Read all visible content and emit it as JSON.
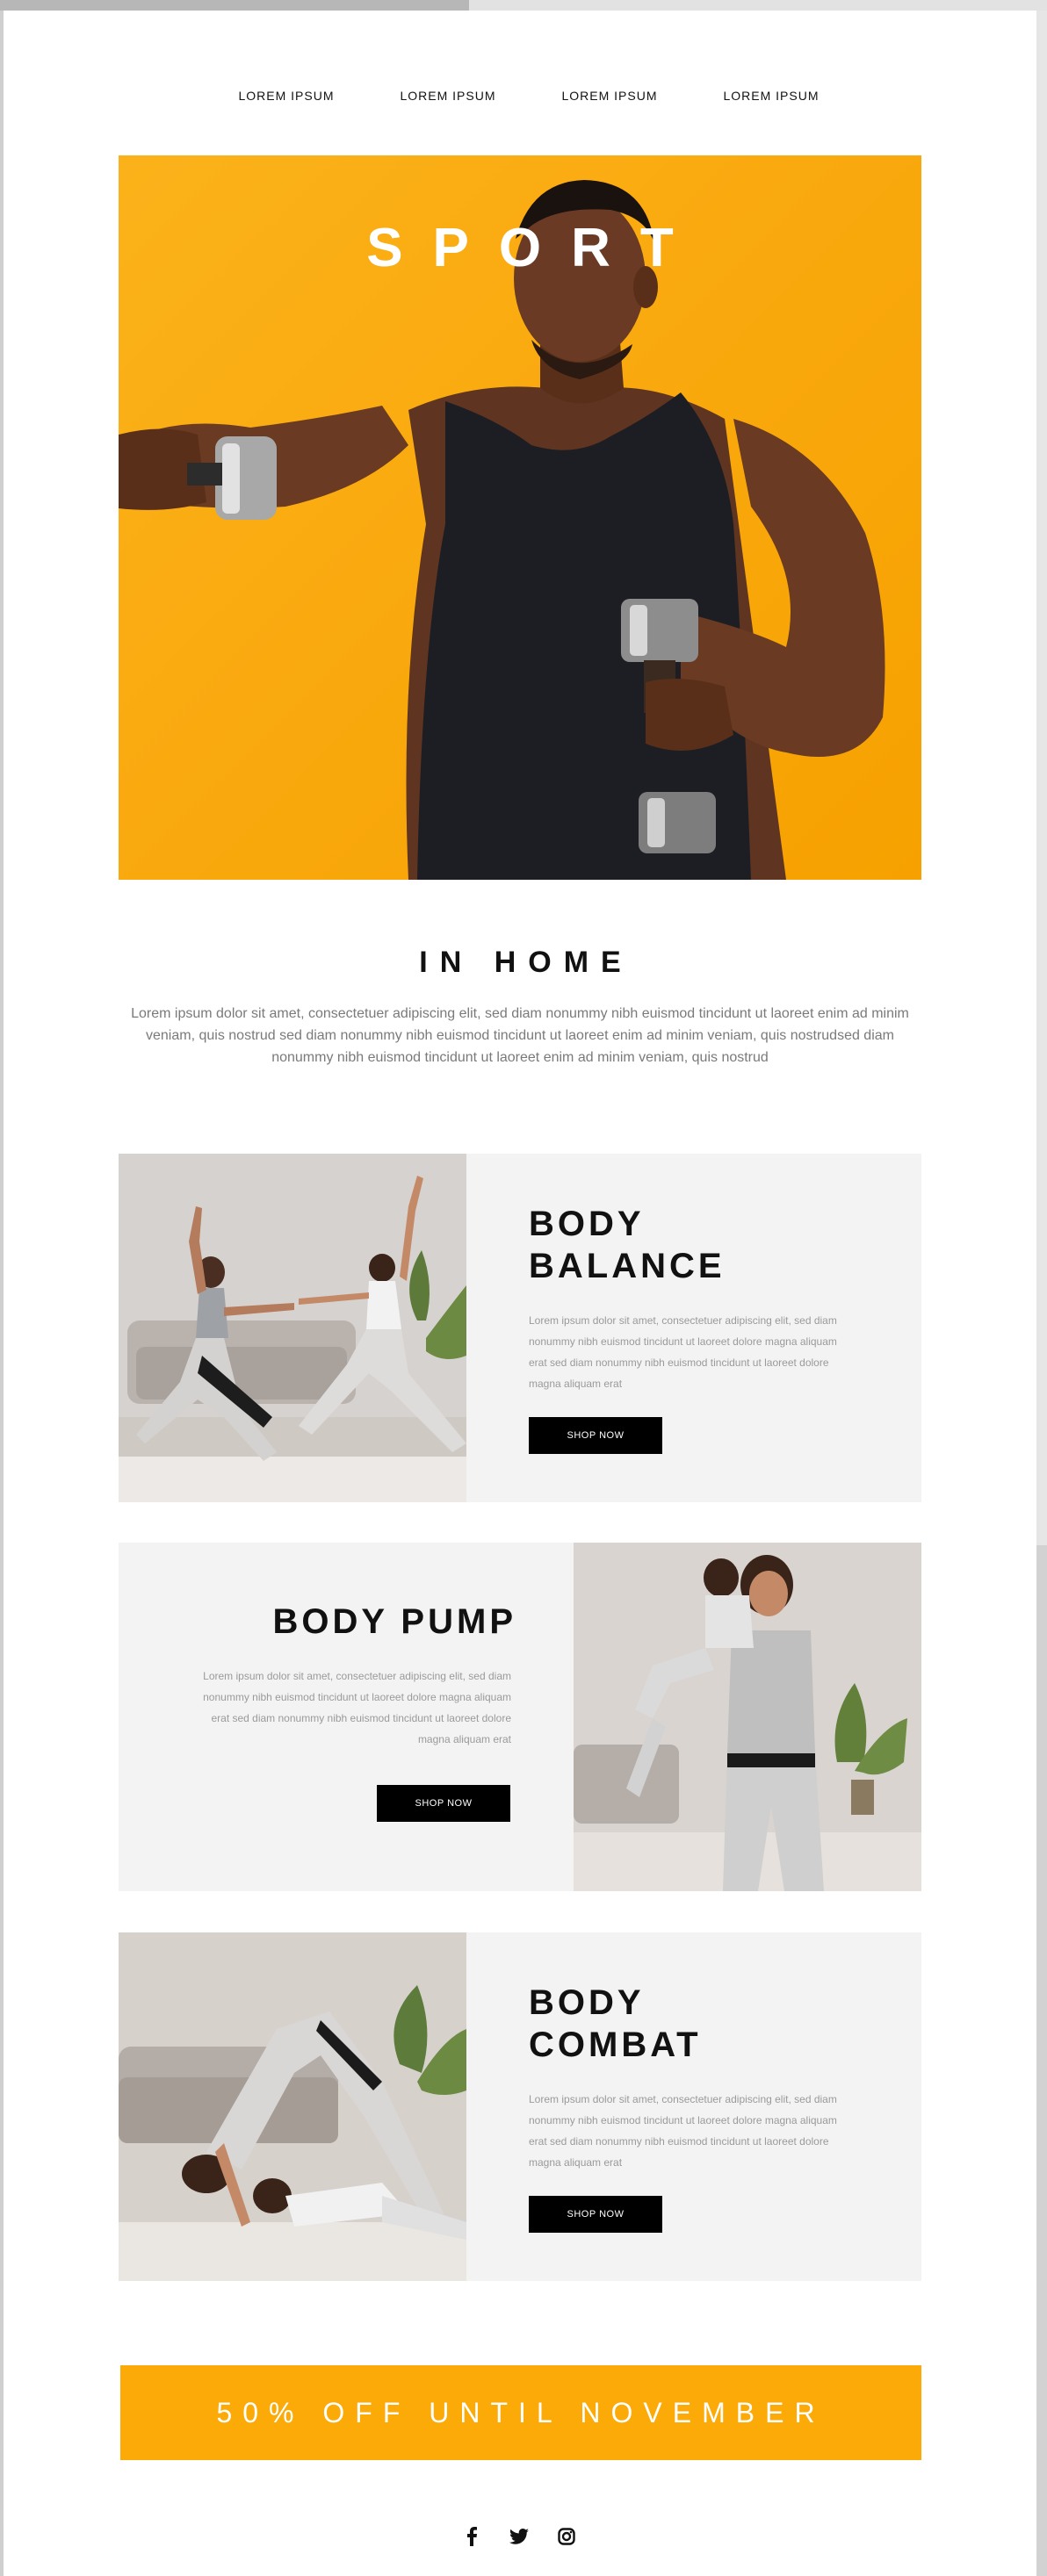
{
  "nav": {
    "links": [
      "LOREM IPSUM",
      "LOREM IPSUM",
      "LOREM IPSUM",
      "LOREM IPSUM"
    ]
  },
  "hero": {
    "title": "SPORT",
    "background_color": "#f9a80c"
  },
  "intro": {
    "title": "IN HOME",
    "text": "Lorem ipsum dolor sit amet, consectetuer adipiscing elit, sed diam nonummy nibh euismod tincidunt ut laoreet enim ad minim veniam, quis nostrud sed diam nonummy nibh euismod tincidunt ut laoreet enim ad minim veniam, quis nostrudsed diam nonummy nibh euismod tincidunt ut laoreet enim ad minim veniam, quis nostrud"
  },
  "features": [
    {
      "title_line1": "BODY",
      "title_line2": "BALANCE",
      "text": "Lorem ipsum dolor sit amet, consectetuer adipiscing elit, sed diam nonummy nibh euismod tincidunt ut laoreet dolore magna aliquam erat  sed diam nonummy nibh euismod tincidunt ut laoreet dolore magna aliquam erat",
      "button": "SHOP NOW"
    },
    {
      "title_line1": "BODY PUMP",
      "title_line2": "",
      "text": "Lorem ipsum dolor sit amet, consectetuer adipiscing elit, sed diam nonummy nibh euismod tincidunt ut laoreet dolore magna aliquam erat  sed diam nonummy nibh euismod tincidunt ut laoreet dolore magna aliquam erat",
      "button": "SHOP NOW"
    },
    {
      "title_line1": "BODY",
      "title_line2": "COMBAT",
      "text": "Lorem ipsum dolor sit amet, consectetuer adipiscing elit, sed diam nonummy nibh euismod tincidunt ut laoreet dolore magna aliquam erat  sed diam nonummy nibh euismod tincidunt ut laoreet dolore magna aliquam erat",
      "button": "SHOP NOW"
    }
  ],
  "banner": {
    "text": "50% OFF UNTIL NOVEMBER",
    "color": "#fbaa07"
  },
  "social": {
    "icons": [
      "facebook-icon",
      "twitter-icon",
      "instagram-icon"
    ]
  }
}
